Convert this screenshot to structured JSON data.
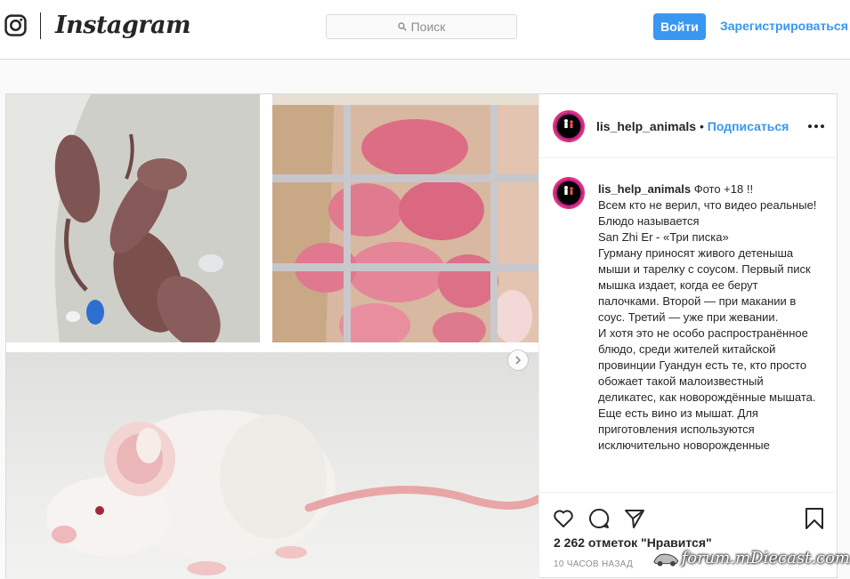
{
  "nav": {
    "brand": "Instagram",
    "search_placeholder": "Поиск",
    "login_label": "Войти",
    "signup_label": "Зарегистрироваться"
  },
  "post": {
    "username": "lis_help_animals",
    "separator": "•",
    "follow_label": "Подписаться",
    "caption_user": "lis_help_animals",
    "caption_lines": [
      "Фото +18 !!",
      "Всем кто не верил, что видео реальные!",
      "Блюдо называется",
      "San Zhi Er - «Три писка»",
      "Гурману приносят живого детеныша мыши и тарелку с соусом. Первый писк мышка издает, когда ее берут палочками. Второй — при макании в соус. Третий — уже при жевании.",
      "И хотя это не особо распространённое блюдо, среди жителей китайской провинции Гуандун есть те, кто просто обожает такой малоизвестный деликатес, как новорождённые мышата.",
      "Еще есть вино из мышат. Для приготовления используются исключительно новорожденные"
    ],
    "likes": "2 262 отметок \"Нравится\"",
    "time_ago": "10 ЧАСОВ НАЗАД"
  },
  "icons": {
    "logo": "instagram-glyph-icon",
    "search": "search-icon",
    "more": "more-options-icon",
    "next": "chevron-right-icon",
    "like": "heart-icon",
    "comment": "comment-icon",
    "share": "paper-plane-icon",
    "save": "bookmark-icon"
  },
  "watermark": "forum.mDiecast.com",
  "colors": {
    "accent": "#3897f0",
    "border": "#dbdbdb",
    "text": "#262626",
    "muted": "#8e8e8e"
  }
}
